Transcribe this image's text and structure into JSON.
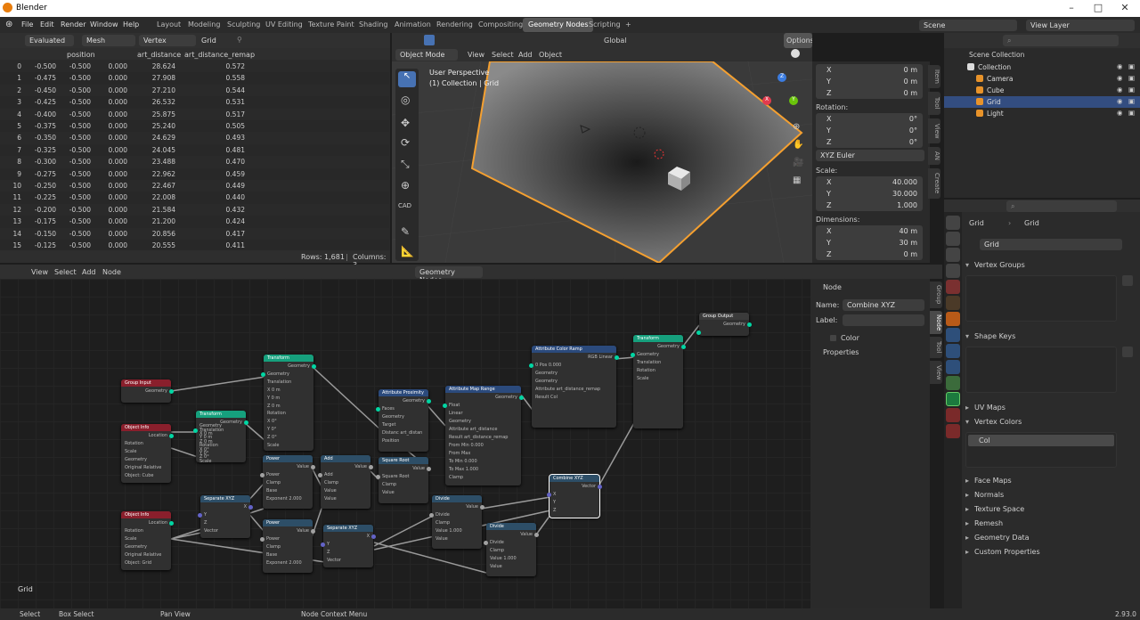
{
  "app": {
    "title": "Blender",
    "version": "2.93.0"
  },
  "menu": [
    "File",
    "Edit",
    "Render",
    "Window",
    "Help"
  ],
  "workspaces": [
    "Layout",
    "Modeling",
    "Sculpting",
    "UV Editing",
    "Texture Paint",
    "Shading",
    "Animation",
    "Rendering",
    "Compositing",
    "Geometry Nodes",
    "Scripting"
  ],
  "active_workspace": "Geometry Nodes",
  "scene": {
    "name": "Scene",
    "view_layer": "View Layer"
  },
  "spreadsheet": {
    "mode": "Evaluated",
    "component": "Mesh",
    "domain": "Vertex",
    "object": "Grid",
    "columns": [
      "position",
      "art_distance",
      "art_distance_remap"
    ],
    "rows": [
      [
        "0",
        "-0.500",
        "-0.500",
        "0.000",
        "28.624",
        "0.572"
      ],
      [
        "1",
        "-0.475",
        "-0.500",
        "0.000",
        "27.908",
        "0.558"
      ],
      [
        "2",
        "-0.450",
        "-0.500",
        "0.000",
        "27.210",
        "0.544"
      ],
      [
        "3",
        "-0.425",
        "-0.500",
        "0.000",
        "26.532",
        "0.531"
      ],
      [
        "4",
        "-0.400",
        "-0.500",
        "0.000",
        "25.875",
        "0.517"
      ],
      [
        "5",
        "-0.375",
        "-0.500",
        "0.000",
        "25.240",
        "0.505"
      ],
      [
        "6",
        "-0.350",
        "-0.500",
        "0.000",
        "24.629",
        "0.493"
      ],
      [
        "7",
        "-0.325",
        "-0.500",
        "0.000",
        "24.045",
        "0.481"
      ],
      [
        "8",
        "-0.300",
        "-0.500",
        "0.000",
        "23.488",
        "0.470"
      ],
      [
        "9",
        "-0.275",
        "-0.500",
        "0.000",
        "22.962",
        "0.459"
      ],
      [
        "10",
        "-0.250",
        "-0.500",
        "0.000",
        "22.467",
        "0.449"
      ],
      [
        "11",
        "-0.225",
        "-0.500",
        "0.000",
        "22.008",
        "0.440"
      ],
      [
        "12",
        "-0.200",
        "-0.500",
        "0.000",
        "21.584",
        "0.432"
      ],
      [
        "13",
        "-0.175",
        "-0.500",
        "0.000",
        "21.200",
        "0.424"
      ],
      [
        "14",
        "-0.150",
        "-0.500",
        "0.000",
        "20.856",
        "0.417"
      ],
      [
        "15",
        "-0.125",
        "-0.500",
        "0.000",
        "20.555",
        "0.411"
      ]
    ],
    "footer": {
      "rows": "Rows: 1,681",
      "columns": "Columns: 3"
    }
  },
  "viewport": {
    "mode": "Object Mode",
    "menus": [
      "View",
      "Select",
      "Add",
      "Object"
    ],
    "orientation": "Global",
    "options": "Options",
    "overlay_title": "User Perspective",
    "overlay_sub": "(1) Collection | Grid"
  },
  "n_panel": {
    "location": [
      [
        "X",
        "0 m"
      ],
      [
        "Y",
        "0 m"
      ],
      [
        "Z",
        "0 m"
      ]
    ],
    "rotation_label": "Rotation:",
    "rotation": [
      [
        "X",
        "0°"
      ],
      [
        "Y",
        "0°"
      ],
      [
        "Z",
        "0°"
      ]
    ],
    "rotation_mode": "XYZ Euler",
    "scale_label": "Scale:",
    "scale": [
      [
        "X",
        "40.000"
      ],
      [
        "Y",
        "30.000"
      ],
      [
        "Z",
        "1.000"
      ]
    ],
    "dimensions_label": "Dimensions:",
    "dimensions": [
      [
        "X",
        "40 m"
      ],
      [
        "Y",
        "30 m"
      ],
      [
        "Z",
        "0 m"
      ]
    ],
    "tabs": [
      "Item",
      "Tool",
      "View",
      "AN",
      "Create"
    ]
  },
  "outliner": {
    "root": "Scene Collection",
    "items": [
      {
        "name": "Collection",
        "indent": 1
      },
      {
        "name": "Camera",
        "indent": 2
      },
      {
        "name": "Cube",
        "indent": 2
      },
      {
        "name": "Grid",
        "indent": 2,
        "selected": true
      },
      {
        "name": "Light",
        "indent": 2
      }
    ]
  },
  "properties": {
    "breadcrumb": [
      "Grid",
      "Grid"
    ],
    "mesh_name": "Grid",
    "sections": [
      "Vertex Groups",
      "Shape Keys",
      "UV Maps",
      "Vertex Colors",
      "Face Maps",
      "Normals",
      "Texture Space",
      "Remesh",
      "Geometry Data",
      "Custom Properties"
    ],
    "vertex_color": "Col"
  },
  "node_editor": {
    "menus": [
      "View",
      "Select",
      "Add",
      "Node"
    ],
    "tree_name": "Geometry Nodes",
    "footer_label": "Grid",
    "side_panel": {
      "header": "Node",
      "name_label": "Name:",
      "name_value": "Combine XYZ",
      "label_label": "Label:",
      "color": "Color",
      "properties": "Properties",
      "tabs": [
        "Group",
        "Node",
        "Tool",
        "View"
      ]
    }
  },
  "nodes": {
    "group_input": {
      "title": "Group Input",
      "out": "Geometry"
    },
    "group_output": {
      "title": "Group Output",
      "in": "Geometry"
    },
    "transform1": {
      "title": "Transform",
      "lines": [
        "Geometry",
        "Geometry",
        "Translation",
        "X  0 m",
        "Y  0 m",
        "Z  0 m",
        "Rotation",
        "X  0°",
        "Y  0°",
        "Z  0°",
        "Scale"
      ]
    },
    "transform2": {
      "title": "Transform",
      "lines": [
        "Geometry",
        "Geometry",
        "Translation",
        "X  0 m",
        "Y  0 m",
        "Z  0 m",
        "Rotation",
        "X  0°",
        "Y  0°",
        "Z  0°",
        "Scale"
      ]
    },
    "transform3": {
      "title": "Transform",
      "lines": [
        "Geometry",
        "Geometry",
        "Translation",
        "Rotation",
        "Scale"
      ]
    },
    "object_info1": {
      "title": "Object Info",
      "lines": [
        "Location",
        "Rotation",
        "Scale",
        "Geometry",
        "Original  Relative",
        "Object:  Cube"
      ]
    },
    "object_info2": {
      "title": "Object Info",
      "lines": [
        "Location",
        "Rotation",
        "Scale",
        "Geometry",
        "Original  Relative",
        "Object:  Grid"
      ]
    },
    "attr_prox": {
      "title": "Attribute Proximity",
      "lines": [
        "Geometry",
        "Faces",
        "Geometry",
        "Target",
        "Distanc  art_distan",
        "Position"
      ]
    },
    "attr_map": {
      "title": "Attribute Map Range",
      "lines": [
        "Geometry",
        "Float",
        "Linear",
        "Geometry",
        "Attribute  art_distance",
        "Result  art_distance_remap",
        "From Min  0.000",
        "From Max",
        "To Min  0.000",
        "To Max  1.000",
        "Clamp"
      ]
    },
    "color_ramp": {
      "title": "Attribute Color Ramp",
      "lines": [
        "RGB  Linear",
        "0  Pos  0.000",
        "Geometry",
        "Geometry",
        "Attribute  art_distance_remap",
        "Result  Col"
      ]
    },
    "power1": {
      "title": "Power",
      "lines": [
        "Value",
        "Power",
        "Clamp",
        "Base",
        "Exponent  2.000"
      ]
    },
    "power2": {
      "title": "Power",
      "lines": [
        "Value",
        "Power",
        "Clamp",
        "Base",
        "Exponent  2.000"
      ]
    },
    "add": {
      "title": "Add",
      "lines": [
        "Value",
        "Add",
        "Clamp",
        "Value",
        "Value"
      ]
    },
    "sqrt": {
      "title": "Square Root",
      "lines": [
        "Value",
        "Square Root",
        "Clamp",
        "Value"
      ]
    },
    "sep1": {
      "title": "Separate XYZ",
      "lines": [
        "X",
        "Y",
        "Z",
        "Vector"
      ]
    },
    "sep2": {
      "title": "Separate XYZ",
      "lines": [
        "X",
        "Y",
        "Z",
        "Vector"
      ]
    },
    "divide1": {
      "title": "Divide",
      "lines": [
        "Value",
        "Divide",
        "Clamp",
        "Value  1.000",
        "Value"
      ]
    },
    "divide2": {
      "title": "Divide",
      "lines": [
        "Value",
        "Divide",
        "Clamp",
        "Value  1.000",
        "Value"
      ]
    },
    "combine": {
      "title": "Combine XYZ",
      "lines": [
        "Vector",
        "X",
        "Y",
        "Z"
      ]
    }
  },
  "statusbar": {
    "items": [
      "Select",
      "Box Select",
      "Pan View",
      "Node Context Menu"
    ]
  }
}
